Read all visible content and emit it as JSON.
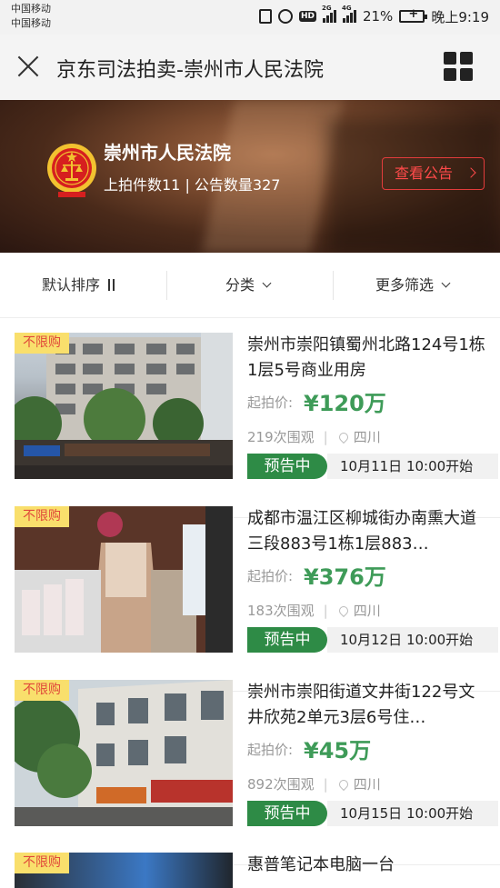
{
  "status_bar": {
    "carrier_1": "中国移动",
    "carrier_2": "中国移动",
    "battery": "21%",
    "time": "晚上9:19",
    "icons": [
      "vibrate-icon",
      "alarm-icon",
      "hd-icon",
      "signal-2g-icon",
      "signal-4g-icon",
      "battery-icon"
    ],
    "signal_1_label": "2G",
    "signal_2_label": "4G",
    "hd_label": "HD"
  },
  "nav": {
    "title": "京东司法拍卖-崇州市人民法院",
    "close_icon": "close-icon",
    "menu_icon": "grid-menu-icon"
  },
  "court": {
    "name": "崇州市人民法院",
    "stats": "上拍件数11 | 公告数量327",
    "notice_button": "查看公告",
    "accent": "#e23c3c"
  },
  "filters": {
    "sort": "默认排序",
    "category": "分类",
    "more": "更多筛选"
  },
  "items": [
    {
      "tag": "不限购",
      "title": "崇州市崇阳镇蜀州北路124号1栋1层5号商业用房",
      "price_label": "起拍价:",
      "price": "¥120万",
      "views": "219次围观",
      "location": "四川",
      "status": "预告中",
      "start": "10月11日 10:00开始"
    },
    {
      "tag": "不限购",
      "title": "成都市温江区柳城街办南熏大道三段883号1栋1层883…",
      "price_label": "起拍价:",
      "price": "¥376万",
      "views": "183次围观",
      "location": "四川",
      "status": "预告中",
      "start": "10月12日 10:00开始"
    },
    {
      "tag": "不限购",
      "title": "崇州市崇阳街道文井街122号文井欣苑2单元3层6号住…",
      "price_label": "起拍价:",
      "price": "¥45万",
      "views": "892次围观",
      "location": "四川",
      "status": "预告中",
      "start": "10月15日 10:00开始"
    },
    {
      "tag": "不限购",
      "title": "惠普笔记本电脑一台"
    }
  ],
  "colors": {
    "price_green": "#3e9b58",
    "status_green": "#2e8b46",
    "tag_yellow": "#f9df6c"
  }
}
